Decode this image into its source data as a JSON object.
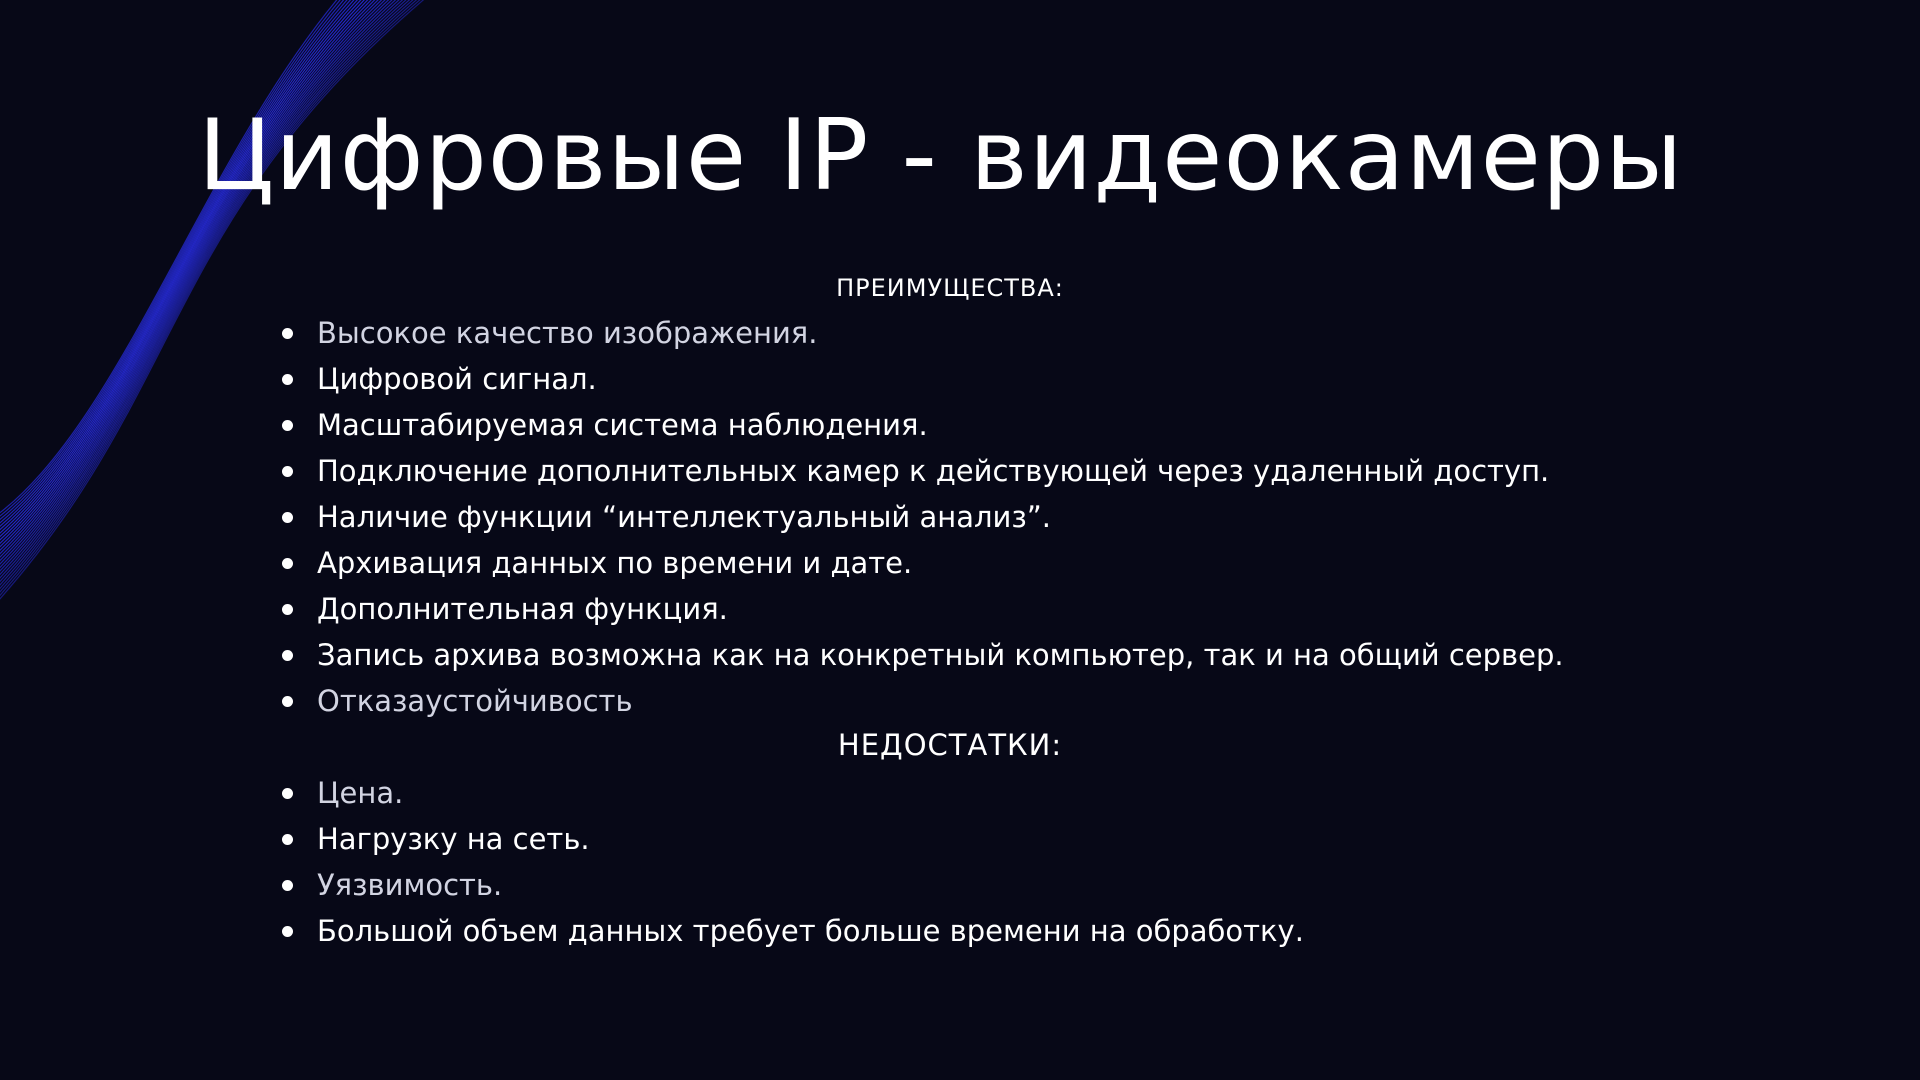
{
  "slide": {
    "title": "Цифровые IP - видеокамеры",
    "pros_heading": "ПРЕИМУЩЕСТВА:",
    "pros": [
      "Высокое качество изображения.",
      "Цифровой сигнал.",
      "Масштабируемая система наблюдения.",
      "Подключение дополнительных камер к действующей через удаленный доступ.",
      "Наличие функции “интеллектуальный анализ”.",
      "Архивация данных по времени и дате.",
      "Дополнительная функция.",
      "Запись архива возможна как на конкретный компьютер, так и на общий сервер.",
      "Отказаустойчивость"
    ],
    "cons_heading": "НЕДОСТАТКИ:",
    "cons": [
      "Цена.",
      "Нагрузку на сеть.",
      "Уязвимость.",
      "Большой объем данных требует больше времени на обработку."
    ]
  },
  "colors": {
    "background": "#070817",
    "text": "#ffffff",
    "wave_accent": "#2a2ff0"
  },
  "icons": {
    "bullet": "bullet-dot-icon",
    "decor": "blue-wave-lines-decoration"
  }
}
